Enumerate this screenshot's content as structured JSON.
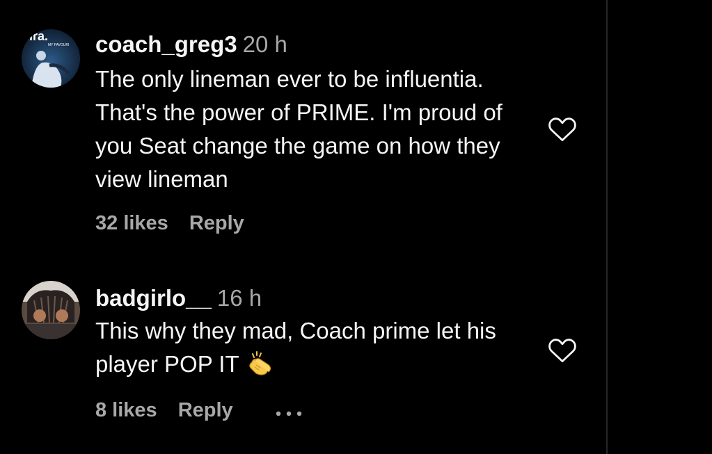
{
  "comments": [
    {
      "username": "coach_greg3",
      "time": "20 h",
      "text": "The only lineman ever to be influentia. That's the power of PRIME. I'm proud of you Seat change the game on how they view lineman",
      "likes": "32 likes",
      "reply_label": "Reply",
      "avatar_text": "MY FAVOURI"
    },
    {
      "username": "badgirlo__",
      "time": "16 h",
      "text": "This why they mad, Coach prime let his player POP IT",
      "emoji": "clapping-hands",
      "likes": "8 likes",
      "reply_label": "Reply"
    }
  ],
  "colors": {
    "background": "#000000",
    "primary_text": "#f5f5f5",
    "secondary_text": "#a8a8a8",
    "divider": "#262626"
  },
  "icons": [
    "heart-icon",
    "more-options-icon",
    "clapping-hands-emoji"
  ]
}
